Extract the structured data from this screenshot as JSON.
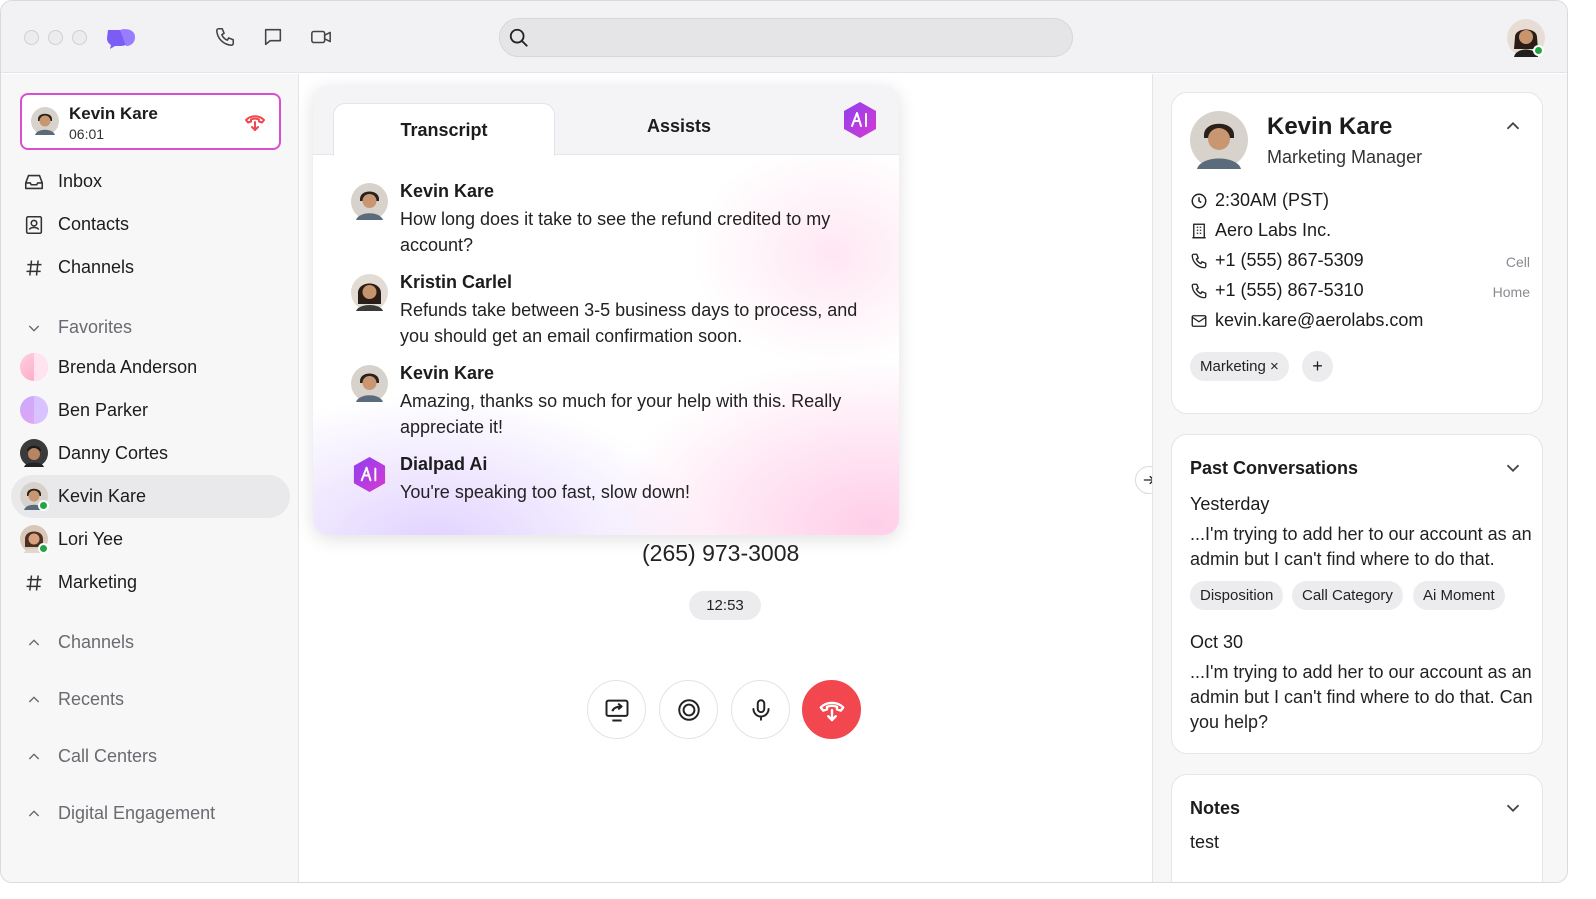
{
  "search": {
    "placeholder": ""
  },
  "active_call": {
    "name": "Kevin Kare",
    "duration": "06:01"
  },
  "sidebar": {
    "nav": [
      {
        "label": "Inbox"
      },
      {
        "label": "Contacts"
      },
      {
        "label": "Channels"
      }
    ],
    "favorites_header": "Favorites",
    "favorites": [
      {
        "label": "Brenda Anderson"
      },
      {
        "label": "Ben Parker"
      },
      {
        "label": "Danny Cortes"
      },
      {
        "label": "Kevin Kare"
      },
      {
        "label": "Lori Yee"
      },
      {
        "label": "Marketing"
      }
    ],
    "sections": [
      {
        "label": "Channels"
      },
      {
        "label": "Recents"
      },
      {
        "label": "Call Centers"
      },
      {
        "label": "Digital Engagement"
      }
    ]
  },
  "panel": {
    "tabs": [
      {
        "label": "Transcript"
      },
      {
        "label": "Assists"
      }
    ],
    "messages": [
      {
        "name": "Kevin Kare",
        "text": "How long does it take to see the refund credited to my account?"
      },
      {
        "name": "Kristin Carlel",
        "text": "Refunds take between 3-5 business days to process, and you should get an email confirmation soon."
      },
      {
        "name": "Kevin Kare",
        "text": "Amazing, thanks so much for your help with this. Really appreciate it!"
      },
      {
        "name": "Dialpad Ai",
        "text": "You're speaking too fast, slow down!"
      }
    ]
  },
  "call": {
    "phone": "(265) 973-3008",
    "timer": "12:53"
  },
  "contact": {
    "name": "Kevin Kare",
    "title": "Marketing Manager",
    "local_time": "2:30AM (PST)",
    "company": "Aero Labs Inc.",
    "phones": [
      {
        "number": "+1 (555) 867-5309",
        "type": "Cell"
      },
      {
        "number": "+1 (555) 867-5310",
        "type": "Home"
      }
    ],
    "email": "kevin.kare@aerolabs.com",
    "tags": [
      {
        "label": "Marketing ×"
      }
    ],
    "add_tag": "+"
  },
  "past_conversations": {
    "title": "Past Conversations",
    "items": [
      {
        "date": "Yesterday",
        "text": "...I'm trying to add her to our account as an admin but I can't find where to do that."
      },
      {
        "date": "Oct 30",
        "text": "...I'm trying to add her to our account as an admin but I can't find where to do that. Can you help?"
      }
    ],
    "chips": [
      {
        "label": "Disposition"
      },
      {
        "label": "Call Category"
      },
      {
        "label": "Ai Moment"
      }
    ]
  },
  "notes": {
    "title": "Notes",
    "text": "test"
  },
  "colors": {
    "accent": "#7b5cf5",
    "end_call": "#f2474f",
    "active_border": "#d94fd0",
    "ai_badge": "#a43be0",
    "presence": "#22a447"
  },
  "icons": {
    "top": [
      "phone-icon",
      "chat-icon",
      "video-icon",
      "search-icon"
    ],
    "controls": [
      "share-screen-icon",
      "record-icon",
      "microphone-icon",
      "end-call-icon"
    ]
  }
}
